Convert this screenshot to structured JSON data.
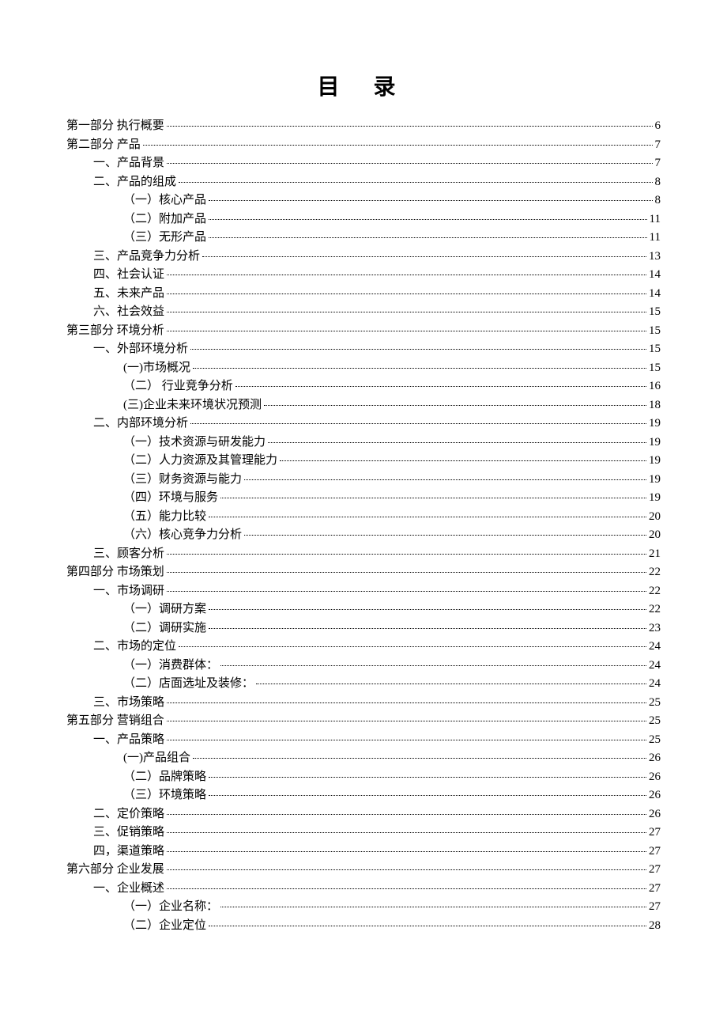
{
  "title": "目 录",
  "entries": [
    {
      "level": 0,
      "label": "第一部分 执行概要",
      "page": "6"
    },
    {
      "level": 0,
      "label": "第二部分  产品",
      "page": "7"
    },
    {
      "level": 1,
      "label": "一、产品背景",
      "page": "7"
    },
    {
      "level": 1,
      "label": "二、产品的组成",
      "page": "8"
    },
    {
      "level": 2,
      "label": "（一）核心产品",
      "page": "8"
    },
    {
      "level": 2,
      "label": "（二）附加产品",
      "page": "11"
    },
    {
      "level": 2,
      "label": "（三）无形产品",
      "page": "11"
    },
    {
      "level": 1,
      "label": "三、产品竞争力分析",
      "page": "13"
    },
    {
      "level": 1,
      "label": "四、社会认证",
      "page": "14"
    },
    {
      "level": 1,
      "label": "五、未来产品",
      "page": "14"
    },
    {
      "level": 1,
      "label": "六、社会效益",
      "page": "15"
    },
    {
      "level": 0,
      "label": "第三部分 环境分析",
      "page": "15"
    },
    {
      "level": 1,
      "label": "一、外部环境分析",
      "page": "15"
    },
    {
      "level": 2,
      "label": "(一)市场概况",
      "page": "15"
    },
    {
      "level": 2,
      "label": "（二） 行业竞争分析",
      "page": "16"
    },
    {
      "level": 2,
      "label": "(三)企业未来环境状况预测",
      "page": "18"
    },
    {
      "level": 1,
      "label": "二、内部环境分析",
      "page": "19"
    },
    {
      "level": 2,
      "label": "（一）技术资源与研发能力",
      "page": "19"
    },
    {
      "level": 2,
      "label": "（二）人力资源及其管理能力",
      "page": "19"
    },
    {
      "level": 2,
      "label": "（三）财务资源与能力",
      "page": "19"
    },
    {
      "level": 2,
      "label": "（四）环境与服务",
      "page": "19"
    },
    {
      "level": 2,
      "label": "（五）能力比较",
      "page": "20"
    },
    {
      "level": 2,
      "label": "（六）核心竞争力分析",
      "page": "20"
    },
    {
      "level": 1,
      "label": "三、顾客分析",
      "page": "21"
    },
    {
      "level": 0,
      "label": "第四部分 市场策划",
      "page": "22"
    },
    {
      "level": 1,
      "label": "一、市场调研",
      "page": "22"
    },
    {
      "level": 2,
      "label": "（一）调研方案",
      "page": "22"
    },
    {
      "level": 2,
      "label": "（二）调研实施",
      "page": "23"
    },
    {
      "level": 1,
      "label": "二、市场的定位",
      "page": "24"
    },
    {
      "level": 2,
      "label": "（一）消费群体：",
      "page": "24"
    },
    {
      "level": 2,
      "label": "（二）店面选址及装修：",
      "page": "24"
    },
    {
      "level": 1,
      "label": "三、市场策略",
      "page": "25"
    },
    {
      "level": 0,
      "label": "第五部分 营销组合",
      "page": "25"
    },
    {
      "level": 1,
      "label": "一、产品策略",
      "page": "25"
    },
    {
      "level": 2,
      "label": "(一)产品组合",
      "page": "26"
    },
    {
      "level": 2,
      "label": "（二）品牌策略",
      "page": "26"
    },
    {
      "level": 2,
      "label": "（三）环境策略",
      "page": "26"
    },
    {
      "level": 1,
      "label": "二、定价策略",
      "page": "26"
    },
    {
      "level": 1,
      "label": "三、促销策略",
      "page": "27"
    },
    {
      "level": 1,
      "label": "四，渠道策略",
      "page": "27"
    },
    {
      "level": 0,
      "label": "第六部分 企业发展",
      "page": "27"
    },
    {
      "level": 1,
      "label": "一、企业概述",
      "page": "27"
    },
    {
      "level": 2,
      "label": "（一）企业名称：",
      "page": "27"
    },
    {
      "level": 2,
      "label": "（二）企业定位",
      "page": "28"
    }
  ]
}
